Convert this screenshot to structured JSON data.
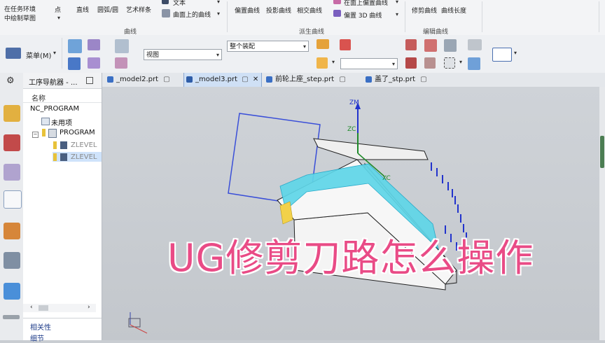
{
  "ribbon": {
    "left_label_1": "在任务环境",
    "left_label_2": "中绘制草图",
    "point": "点",
    "line": "直线",
    "arc": "圆弧/圆",
    "art_spline": "艺术样条",
    "text": "文本",
    "curve_on_surface": "曲面上的曲线",
    "group_curve": "曲线",
    "offset_curve": "偏置曲线",
    "project_curve": "投影曲线",
    "intersect_curve": "相交曲线",
    "isoparam": "在面上偏置曲线",
    "offset_3d": "偏置 3D 曲线",
    "group_derived": "派生曲线",
    "trim_curve": "修剪曲线",
    "curve_length": "曲线长度",
    "group_edit": "编辑曲线"
  },
  "toolbar": {
    "menu_label": "菜单(M)",
    "view_combo": "视图",
    "assembly_combo": "整个装配",
    "empty_combo": ""
  },
  "navigator": {
    "title": "工序导航器 - ...",
    "col_name": "名称",
    "root": "NC_PROGRAM",
    "unused": "未用项",
    "program": "PROGRAM",
    "op1": "ZLEVEL",
    "op2": "ZLEVEL",
    "dependency": "相关性",
    "details": "细节"
  },
  "tabs": [
    {
      "label": "_model2.prt"
    },
    {
      "label": "_model3.prt"
    },
    {
      "label": "前轮上座_step.prt"
    },
    {
      "label": "盖了_stp.prt"
    }
  ],
  "viewport": {
    "overlay_title": "UG修剪刀路怎么操作",
    "axis_zm": "ZM",
    "axis_zc": "ZC",
    "axis_xc": "XC"
  },
  "colors": {
    "accent": "#e94b86",
    "toolpath_cyan": "#55d3e6",
    "toolpath_blue": "#2233cc",
    "model_face": "#f2f2f2"
  }
}
